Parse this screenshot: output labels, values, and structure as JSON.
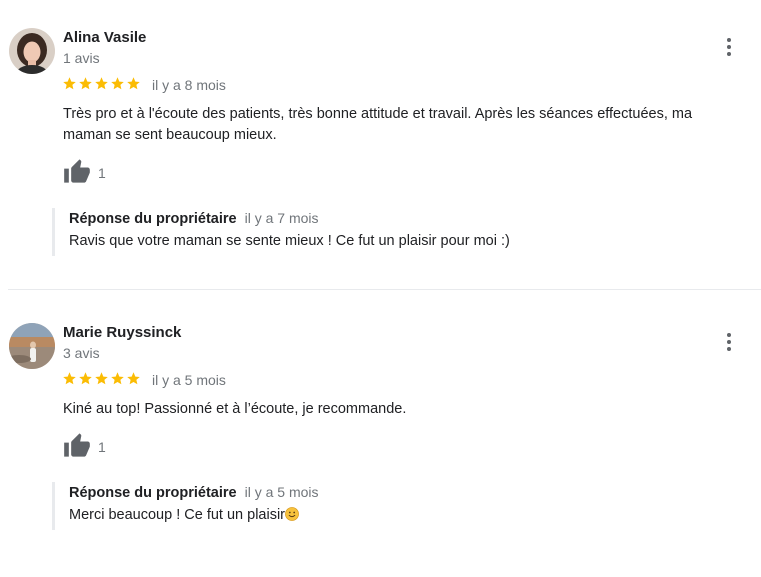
{
  "colors": {
    "star": "#fbbc04",
    "muted": "#70757a",
    "icon": "#5f6368",
    "text": "#202124",
    "divider": "#e8eaed"
  },
  "reviews": [
    {
      "name": "Alina Vasile",
      "count": "1 avis",
      "rating": 5,
      "when": "il y a 8 mois",
      "text": "Très pro et à l'écoute des patients, très bonne attitude et travail. Après les séances effectuées, ma maman se sent beaucoup mieux.",
      "likes": "1",
      "reply_label": "Réponse du propriétaire",
      "reply_when": "il y a 7 mois",
      "reply_text": "Ravis que votre maman se sente mieux ! Ce fut un plaisir pour moi :)"
    },
    {
      "name": "Marie Ruyssinck",
      "count": "3 avis",
      "rating": 5,
      "when": "il y a 5 mois",
      "text": "Kiné au top! Passionné et à l’écoute, je recommande.",
      "likes": "1",
      "reply_label": "Réponse du propriétaire",
      "reply_when": "il y a 5 mois",
      "reply_text": "Merci beaucoup ! Ce fut un plaisir",
      "reply_emoji": "slightly-smiling-face-icon"
    }
  ]
}
